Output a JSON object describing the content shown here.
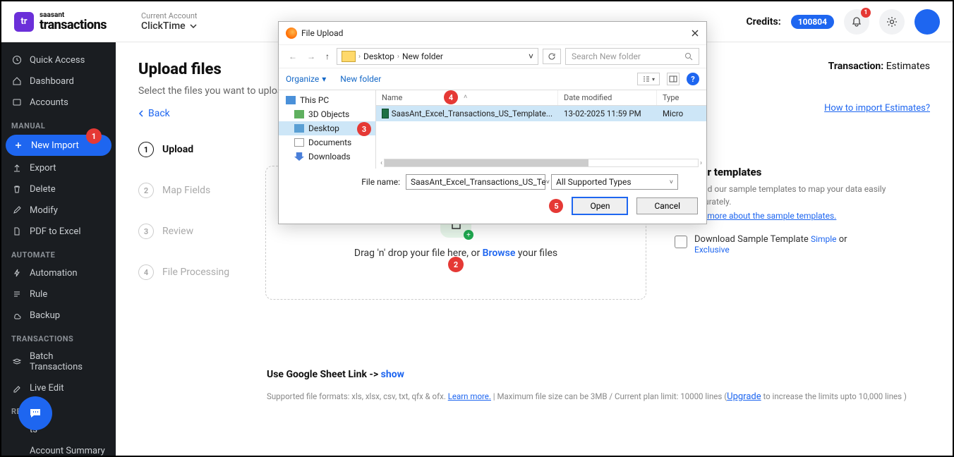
{
  "header": {
    "logo_brand": "saasant",
    "logo_app": "transactions",
    "logo_sq": "tr",
    "account_label": "Current Account",
    "account_name": "ClickTime",
    "credits_label": "Credits:",
    "credits_value": "100804",
    "notif_count": "1"
  },
  "sidebar": {
    "items1": [
      {
        "label": "Quick Access"
      },
      {
        "label": "Dashboard"
      },
      {
        "label": "Accounts"
      }
    ],
    "h_manual": "MANUAL",
    "items2": [
      {
        "label": "New Import",
        "active": true
      },
      {
        "label": "Export"
      },
      {
        "label": "Delete"
      },
      {
        "label": "Modify"
      },
      {
        "label": "PDF to Excel"
      }
    ],
    "h_auto": "AUTOMATE",
    "items3": [
      {
        "label": "Automation"
      },
      {
        "label": "Rule"
      },
      {
        "label": "Backup"
      }
    ],
    "h_txn": "TRANSACTIONS",
    "items4": [
      {
        "label": "Batch Transactions"
      },
      {
        "label": "Live Edit"
      }
    ],
    "h_rep": "REPORTS",
    "items5": [
      {
        "label": "ts"
      },
      {
        "label": "Account Summary"
      }
    ],
    "badge1": "1"
  },
  "main": {
    "title": "Upload files",
    "subtitle": "Select the files you want to upload",
    "txn_prefix": "Transaction:",
    "txn_value": "Estimates",
    "help": "How to import Estimates?",
    "back": "Back",
    "steps": [
      {
        "n": "1",
        "label": "Upload",
        "active": true
      },
      {
        "n": "2",
        "label": "Map Fields"
      },
      {
        "n": "3",
        "label": "Review"
      },
      {
        "n": "4",
        "label": "File Processing"
      }
    ],
    "drop_pre": "Drag 'n' drop your file here, or ",
    "drop_browse": "Browse",
    "drop_post": " your files",
    "badge2": "2",
    "templates": {
      "title": "Use our templates",
      "desc": "Download our sample templates to map your data easily and accurately.",
      "link": "Find out more about the sample templates.",
      "dl_pre": "Download Sample Template ",
      "dl_simple": "Simple",
      "dl_or": " or ",
      "dl_excl": "Exclusive"
    },
    "gsheet_pre": "Use Google Sheet Link -> ",
    "gsheet_show": "show",
    "formats_pre": "Supported file formats: xls, xlsx, csv, txt, qfx & ofx. ",
    "formats_learn": "Learn more.",
    "formats_mid": "   |   Maximum file size can be 3MB / Current plan limit: 10000 lines (",
    "formats_upgrade": "Upgrade",
    "formats_end": " to increase the limits upto 10,000 lines )"
  },
  "dialog": {
    "title": "File Upload",
    "crumb1": "Desktop",
    "crumb2": "New folder",
    "search_ph": "Search New folder",
    "organize": "Organize",
    "newfolder": "New folder",
    "tree": {
      "pc": "This PC",
      "d3": "3D Objects",
      "desk": "Desktop",
      "docs": "Documents",
      "dl": "Downloads"
    },
    "cols": {
      "name": "Name",
      "date": "Date modified",
      "type": "Type"
    },
    "row": {
      "name": "SaasAnt_Excel_Transactions_US_Template...",
      "date": "13-02-2025 11:59 PM",
      "type": "Micro"
    },
    "fname_label": "File name:",
    "fname_value": "SaasAnt_Excel_Transactions_US_Te",
    "ftype": "All Supported Types",
    "open": "Open",
    "cancel": "Cancel",
    "badge3": "3",
    "badge4": "4",
    "badge5": "5"
  }
}
